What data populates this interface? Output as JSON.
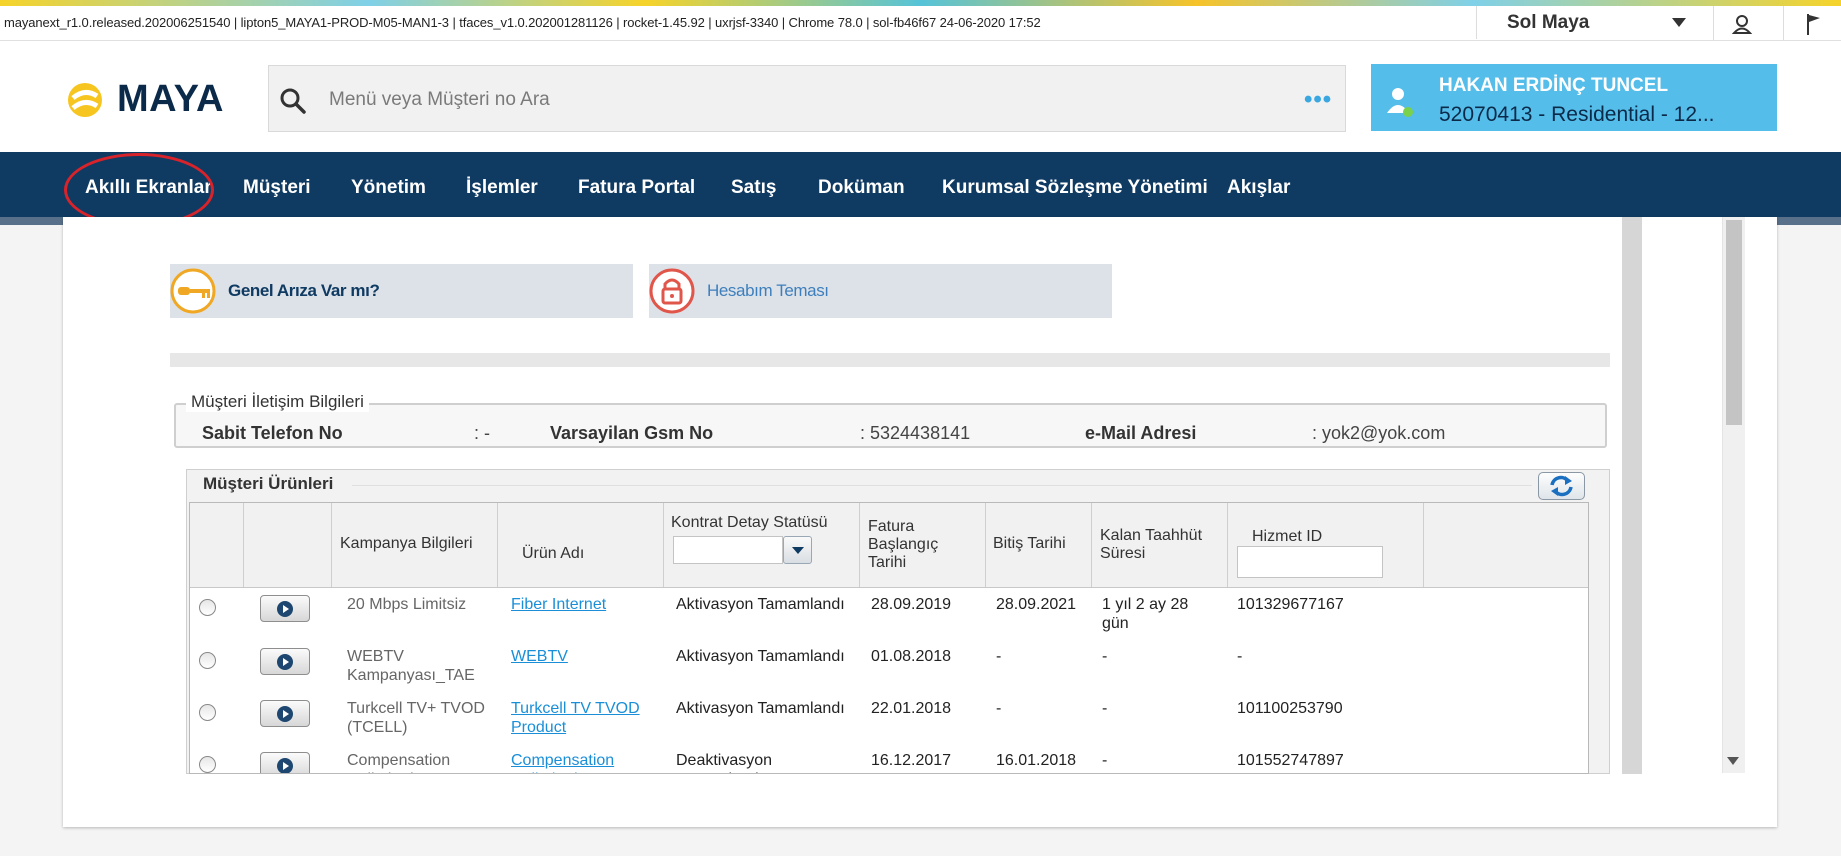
{
  "topbar": {
    "build_info": "mayanext_r1.0.released.202006251540 | lipton5_MAYA1-PROD-M05-MAN1-3 | tfaces_v1.0.202001281126 | rocket-1.45.92 | uxrjsf-3340 | Chrome 78.0 | sol-fb46f67 24-06-2020 17:52",
    "user_select": "Sol Maya"
  },
  "header": {
    "logo_text": "MAYA",
    "search_placeholder": "Menü veya Müşteri no Ara",
    "more_dots": "•••",
    "customer_name": "HAKAN ERDİNÇ TUNCEL",
    "customer_sub": "52070413 - Residential - 12..."
  },
  "nav": {
    "items": [
      "Akıllı Ekranlar",
      "Müşteri",
      "Yönetim",
      "İşlemler",
      "Fatura Portal",
      "Satış",
      "Doküman",
      "Kurumsal Sözleşme Yönetimi",
      "Akışlar"
    ]
  },
  "quick_links": {
    "fault": "Genel Arıza Var mı?",
    "theme": "Hesabım Teması"
  },
  "contact": {
    "legend": "Müşteri İletişim Bilgileri",
    "fixed_phone_label": "Sabit Telefon No",
    "fixed_phone_value": ": -",
    "gsm_label": "Varsayilan Gsm No",
    "gsm_value": ": 5324438141",
    "email_label": "e-Mail Adresi",
    "email_value": ": yok2@yok.com"
  },
  "products": {
    "title": "Müşteri Ürünleri",
    "headers": {
      "campaign": "Kampanya Bilgileri",
      "product": "Ürün Adı",
      "contract_status": "Kontrat Detay Statüsü",
      "invoice_start": "Fatura\nBaşlangıç\nTarihi",
      "end_date": "Bitiş Tarihi",
      "remaining": "Kalan Taahhüt\nSüresi",
      "service_id": "Hizmet ID"
    },
    "rows": [
      {
        "campaign": "20 Mbps Limitsiz",
        "product": "Fiber Internet",
        "status": "Aktivasyon Tamamlandı",
        "start": "28.09.2019",
        "end": "28.09.2021",
        "remaining": "1 yıl 2 ay 28\ngün",
        "service_id": "101329677167"
      },
      {
        "campaign": "WEBTV\nKampanyası_TAE",
        "product": "WEBTV",
        "status": "Aktivasyon Tamamlandı",
        "start": "01.08.2018",
        "end": "-",
        "remaining": "-",
        "service_id": "-"
      },
      {
        "campaign": "Turkcell TV+ TVOD\n(TCELL)",
        "product": "Turkcell TV TVOD\nProduct",
        "status": "Aktivasyon Tamamlandı",
        "start": "22.01.2018",
        "end": "-",
        "remaining": "-",
        "service_id": "101100253790"
      },
      {
        "campaign": "Compensation\nUnlimited ADD",
        "product": "Compensation\nUnlimited ADD",
        "status": "Deaktivasyon\nTamamlandı",
        "start": "16.12.2017",
        "end": "16.01.2018",
        "remaining": "-",
        "service_id": "101552747897"
      }
    ]
  },
  "colors": {
    "nav_bg": "#0f3a62",
    "accent_blue": "#55bde9",
    "highlight_red": "#d8232a",
    "logo_yellow": "#f7c520"
  }
}
